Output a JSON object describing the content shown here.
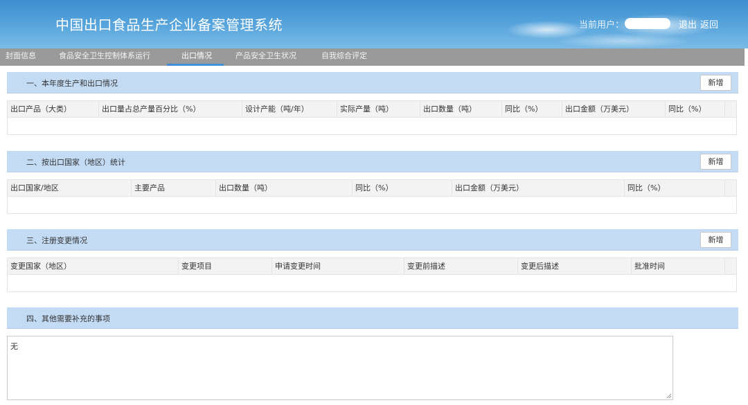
{
  "app": {
    "title": "中国出口食品生产企业备案管理系统"
  },
  "user": {
    "label": "当前用户：",
    "logout": "退出",
    "back": "返回"
  },
  "nav": {
    "tabs": [
      {
        "label": "封面信息",
        "active": false
      },
      {
        "label": "食品安全卫生控制体系运行",
        "active": false
      },
      {
        "label": "出口情况",
        "active": true
      },
      {
        "label": "产品安全卫生状况",
        "active": false
      },
      {
        "label": "自我综合评定",
        "active": false
      }
    ]
  },
  "sections": [
    {
      "title": "一、本年度生产和出口情况",
      "add_label": "新增",
      "columns": [
        "出口产品（大类）",
        "出口量占总产量百分比（%）",
        "设计产能（吨/年）",
        "实际产量（吨）",
        "出口数量（吨）",
        "同比（%）",
        "出口金额（万美元）",
        "同比（%）"
      ]
    },
    {
      "title": "二、按出口国家（地区）统计",
      "add_label": "新增",
      "columns": [
        "出口国家/地区",
        "主要产品",
        "出口数量（吨）",
        "同比（%）",
        "出口金额（万美元）",
        "同比（%）"
      ]
    },
    {
      "title": "三、注册变更情况",
      "add_label": "新增",
      "columns": [
        "变更国家（地区）",
        "变更项目",
        "申请变更时间",
        "变更前描述",
        "变更后描述",
        "批准时间"
      ]
    },
    {
      "title": "四、其他需要补充的事项"
    }
  ],
  "remarks": {
    "value": "无"
  },
  "colors": {
    "header": "#4a9ad6",
    "nav": "#9a9a9a",
    "section_bar": "#c4dbf4",
    "active_tab_underline": "#3f8ed6"
  }
}
